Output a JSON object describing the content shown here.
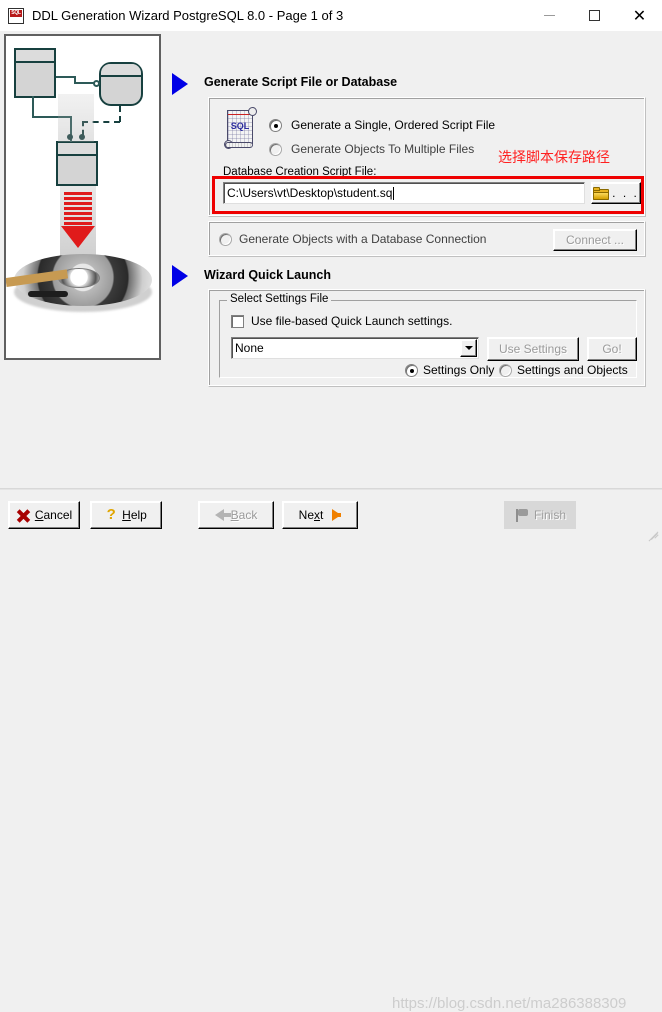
{
  "window": {
    "title": "DDL Generation Wizard PostgreSQL 8.0 - Page 1 of 3",
    "icon": "sql-app-icon",
    "minimize_label": "",
    "maximize_label": "",
    "close_label": "✕"
  },
  "illustration": {
    "name": "ddl-generation-illustration",
    "description": "entity boxes flowing into a disk platter"
  },
  "sections": [
    {
      "marker": "blue-triangle",
      "title": "Generate Script File or Database"
    },
    {
      "marker": "blue-triangle",
      "title": "Wizard Quick Launch"
    }
  ],
  "script_panel": {
    "icon": "sql-scroll-icon",
    "icon_text": "SQL",
    "options": [
      {
        "label": "Generate a Single, Ordered Script File",
        "selected": true
      },
      {
        "label": "Generate Objects To Multiple Files",
        "selected": false
      }
    ],
    "file_label": "Database Creation Script File:",
    "file_value": "C:\\Users\\vt\\Desktop\\student.sq",
    "file_placeholder": "",
    "browse_label": ". . .",
    "browse_icon": "folder-icon"
  },
  "connection_panel": {
    "option_label": "Generate Objects with a Database Connection",
    "option_selected": false,
    "connect_label": "Connect ...",
    "connect_enabled": false
  },
  "quick_launch": {
    "groupbox_label": "Select Settings File",
    "checkbox_label": "Use file-based Quick Launch settings.",
    "checkbox_checked": false,
    "combo_value": "None",
    "use_settings_label": "Use Settings",
    "use_settings_enabled": false,
    "go_label": "Go!",
    "go_enabled": false,
    "radios": [
      {
        "label": "Settings Only",
        "selected": true
      },
      {
        "label": "Settings and Objects",
        "selected": false
      }
    ]
  },
  "annotations": {
    "note_text": "选择脚本保存路径",
    "note_color": "#ff2020",
    "highlight_color": "#ee0000"
  },
  "footer": {
    "buttons": [
      {
        "name": "cancel",
        "label": "Cancel",
        "icon": "red-x-icon",
        "enabled": true
      },
      {
        "name": "help",
        "label": "Help",
        "icon": "question-mark-icon",
        "enabled": true
      },
      {
        "name": "back",
        "label": "Back",
        "icon": "left-arrow-icon",
        "enabled": false
      },
      {
        "name": "next",
        "label": "Next",
        "icon": "right-arrow-icon",
        "enabled": true
      },
      {
        "name": "finish",
        "label": "Finish",
        "icon": "flag-icon",
        "enabled": false
      }
    ],
    "watermark": "https://blog.csdn.net/ma286388309"
  }
}
